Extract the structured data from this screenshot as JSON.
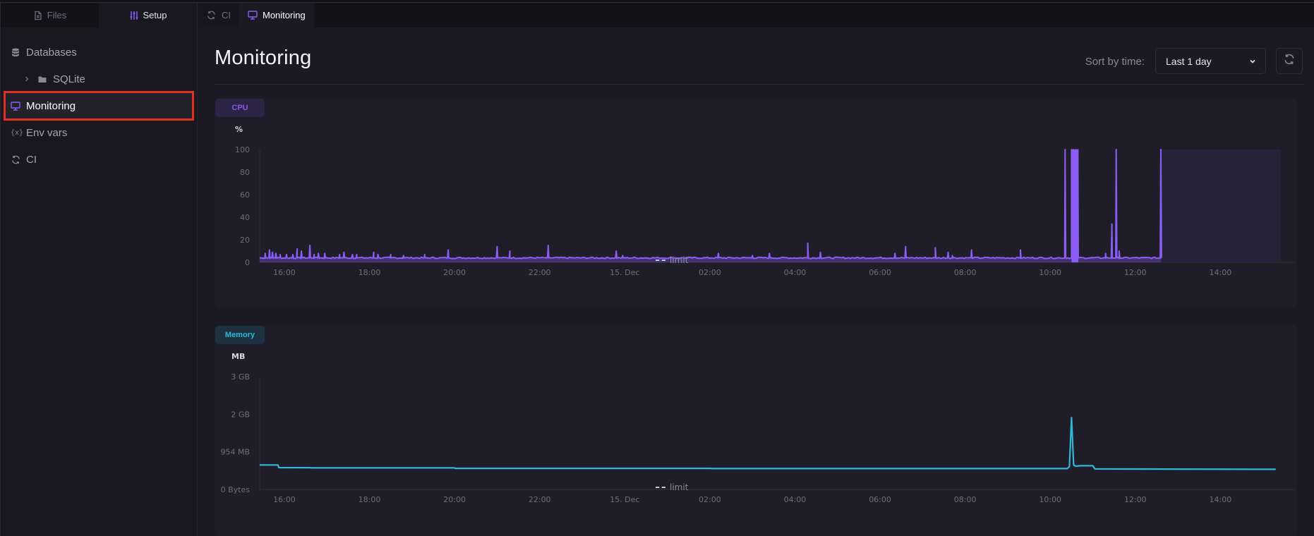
{
  "sidebar": {
    "tabs": [
      {
        "label": "Files",
        "icon": "file-icon",
        "active": false
      },
      {
        "label": "Setup",
        "icon": "sliders-icon",
        "active": true
      }
    ],
    "items": [
      {
        "label": "Databases",
        "icon": "database-icon"
      },
      {
        "label": "SQLite",
        "icon": "folder-icon",
        "expandable": true
      },
      {
        "label": "Monitoring",
        "icon": "monitor-icon",
        "active": true
      },
      {
        "label": "Env vars",
        "icon": "variable-icon",
        "icon_text": "{x}"
      },
      {
        "label": "CI",
        "icon": "refresh-icon"
      }
    ]
  },
  "tabs": [
    {
      "label": "CI",
      "icon": "refresh-icon",
      "active": false
    },
    {
      "label": "Monitoring",
      "icon": "monitor-icon",
      "active": true
    }
  ],
  "header": {
    "title": "Monitoring",
    "sort_label": "Sort by time:",
    "sort_value": "Last 1 day"
  },
  "colors": {
    "accent": "#8b5cf6",
    "cpu": "#8b5cf6",
    "memory": "#2fb6d8",
    "highlight": "#e3301f"
  },
  "chart_data": [
    {
      "type": "line",
      "title": "CPU",
      "ylabel": "%",
      "ylim": [
        0,
        100
      ],
      "yticks": [
        "0",
        "20",
        "40",
        "60",
        "80",
        "100"
      ],
      "ytick_values": [
        0,
        20,
        40,
        60,
        80,
        100
      ],
      "xlim_hours": [
        -0.58,
        23.42
      ],
      "xticks": [
        "16:00",
        "18:00",
        "20:00",
        "22:00",
        "15. Dec",
        "02:00",
        "04:00",
        "06:00",
        "08:00",
        "10:00",
        "12:00",
        "14:00"
      ],
      "xtick_hours": [
        0,
        2,
        4,
        6,
        8,
        10,
        12,
        14,
        16,
        18,
        20,
        22
      ],
      "legend": [
        {
          "label": "limit",
          "style": "dashed"
        }
      ],
      "legend_position": "bottom-center",
      "baseline": 4,
      "data_end_hour": 20.6,
      "shaded_region_hours": [
        20.6,
        23.42
      ],
      "spikes": [
        {
          "h": -0.45,
          "v": 8
        },
        {
          "h": -0.35,
          "v": 11
        },
        {
          "h": -0.28,
          "v": 9
        },
        {
          "h": -0.2,
          "v": 8
        },
        {
          "h": -0.1,
          "v": 7
        },
        {
          "h": 0.05,
          "v": 7
        },
        {
          "h": 0.2,
          "v": 7
        },
        {
          "h": 0.3,
          "v": 12
        },
        {
          "h": 0.4,
          "v": 10
        },
        {
          "h": 0.6,
          "v": 15
        },
        {
          "h": 0.7,
          "v": 7
        },
        {
          "h": 0.8,
          "v": 8
        },
        {
          "h": 0.95,
          "v": 8
        },
        {
          "h": 1.3,
          "v": 7
        },
        {
          "h": 1.4,
          "v": 9
        },
        {
          "h": 1.6,
          "v": 7
        },
        {
          "h": 1.7,
          "v": 7
        },
        {
          "h": 2.1,
          "v": 9
        },
        {
          "h": 2.2,
          "v": 7
        },
        {
          "h": 2.5,
          "v": 7
        },
        {
          "h": 2.8,
          "v": 6
        },
        {
          "h": 3.3,
          "v": 7
        },
        {
          "h": 3.85,
          "v": 11
        },
        {
          "h": 5.0,
          "v": 14
        },
        {
          "h": 5.3,
          "v": 10
        },
        {
          "h": 6.2,
          "v": 15
        },
        {
          "h": 7.8,
          "v": 10
        },
        {
          "h": 7.95,
          "v": 6
        },
        {
          "h": 10.2,
          "v": 8
        },
        {
          "h": 11.0,
          "v": 6
        },
        {
          "h": 11.4,
          "v": 8
        },
        {
          "h": 12.3,
          "v": 17
        },
        {
          "h": 12.6,
          "v": 9
        },
        {
          "h": 14.35,
          "v": 8
        },
        {
          "h": 14.6,
          "v": 14
        },
        {
          "h": 15.3,
          "v": 13
        },
        {
          "h": 15.6,
          "v": 9
        },
        {
          "h": 15.7,
          "v": 6
        },
        {
          "h": 16.15,
          "v": 11
        },
        {
          "h": 17.3,
          "v": 11
        },
        {
          "h": 18.35,
          "v": 100
        },
        {
          "h": 18.5,
          "v": 100
        },
        {
          "h": 18.55,
          "v": 100
        },
        {
          "h": 18.6,
          "v": 100
        },
        {
          "h": 18.65,
          "v": 100
        },
        {
          "h": 19.3,
          "v": 8
        },
        {
          "h": 19.45,
          "v": 34
        },
        {
          "h": 19.55,
          "v": 100
        },
        {
          "h": 19.62,
          "v": 10
        },
        {
          "h": 20.6,
          "v": 100
        }
      ]
    },
    {
      "type": "line",
      "title": "Memory",
      "ylabel": "MB",
      "ylim_mb": [
        0,
        2861
      ],
      "yticks": [
        "0 Bytes",
        "954 MB",
        "2 GB",
        "3 GB"
      ],
      "ytick_values_mb": [
        0,
        954,
        1907,
        2861
      ],
      "xlim_hours": [
        -0.58,
        23.42
      ],
      "xticks": [
        "16:00",
        "18:00",
        "20:00",
        "22:00",
        "15. Dec",
        "02:00",
        "04:00",
        "06:00",
        "08:00",
        "10:00",
        "12:00",
        "14:00"
      ],
      "xtick_hours": [
        0,
        2,
        4,
        6,
        8,
        10,
        12,
        14,
        16,
        18,
        20,
        22
      ],
      "legend": [
        {
          "label": "limit",
          "style": "dashed"
        }
      ],
      "legend_position": "bottom-center",
      "points": [
        [
          -0.58,
          620
        ],
        [
          -0.15,
          620
        ],
        [
          -0.13,
          555
        ],
        [
          0.6,
          553
        ],
        [
          0.65,
          548
        ],
        [
          4.0,
          548
        ],
        [
          4.02,
          535
        ],
        [
          10.0,
          535
        ],
        [
          10.05,
          530
        ],
        [
          18.4,
          530
        ],
        [
          18.45,
          580
        ],
        [
          18.5,
          1820
        ],
        [
          18.55,
          620
        ],
        [
          18.6,
          590
        ],
        [
          18.7,
          600
        ],
        [
          19.0,
          600
        ],
        [
          19.05,
          520
        ],
        [
          23.3,
          512
        ]
      ]
    }
  ]
}
